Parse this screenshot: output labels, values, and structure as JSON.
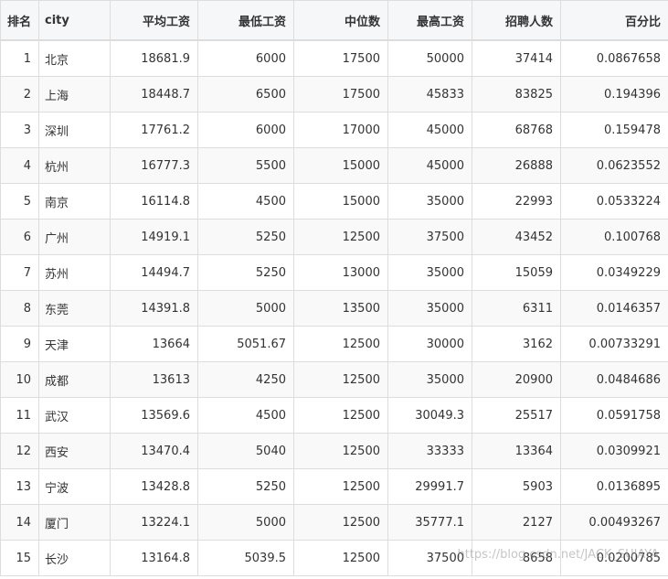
{
  "table": {
    "columns": [
      "排名",
      "city",
      "平均工资",
      "最低工资",
      "中位数",
      "最高工资",
      "招聘人数",
      "百分比"
    ],
    "rows": [
      [
        "1",
        "北京",
        "18681.9",
        "6000",
        "17500",
        "50000",
        "37414",
        "0.0867658"
      ],
      [
        "2",
        "上海",
        "18448.7",
        "6500",
        "17500",
        "45833",
        "83825",
        "0.194396"
      ],
      [
        "3",
        "深圳",
        "17761.2",
        "6000",
        "17000",
        "45000",
        "68768",
        "0.159478"
      ],
      [
        "4",
        "杭州",
        "16777.3",
        "5500",
        "15000",
        "45000",
        "26888",
        "0.0623552"
      ],
      [
        "5",
        "南京",
        "16114.8",
        "4500",
        "15000",
        "35000",
        "22993",
        "0.0533224"
      ],
      [
        "6",
        "广州",
        "14919.1",
        "5250",
        "12500",
        "37500",
        "43452",
        "0.100768"
      ],
      [
        "7",
        "苏州",
        "14494.7",
        "5250",
        "13000",
        "35000",
        "15059",
        "0.0349229"
      ],
      [
        "8",
        "东莞",
        "14391.8",
        "5000",
        "13500",
        "35000",
        "6311",
        "0.0146357"
      ],
      [
        "9",
        "天津",
        "13664",
        "5051.67",
        "12500",
        "30000",
        "3162",
        "0.00733291"
      ],
      [
        "10",
        "成都",
        "13613",
        "4250",
        "12500",
        "35000",
        "20900",
        "0.0484686"
      ],
      [
        "11",
        "武汉",
        "13569.6",
        "4500",
        "12500",
        "30049.3",
        "25517",
        "0.0591758"
      ],
      [
        "12",
        "西安",
        "13470.4",
        "5040",
        "12500",
        "33333",
        "13364",
        "0.0309921"
      ],
      [
        "13",
        "宁波",
        "13428.8",
        "5250",
        "12500",
        "29991.7",
        "5903",
        "0.0136895"
      ],
      [
        "14",
        "厦门",
        "13224.1",
        "5000",
        "12500",
        "35777.1",
        "2127",
        "0.00493267"
      ],
      [
        "15",
        "长沙",
        "13164.8",
        "5039.5",
        "12500",
        "37500",
        "8658",
        "0.0200785"
      ]
    ]
  },
  "watermark": "https://blog.csdn.net/JACK_SUJAYA"
}
